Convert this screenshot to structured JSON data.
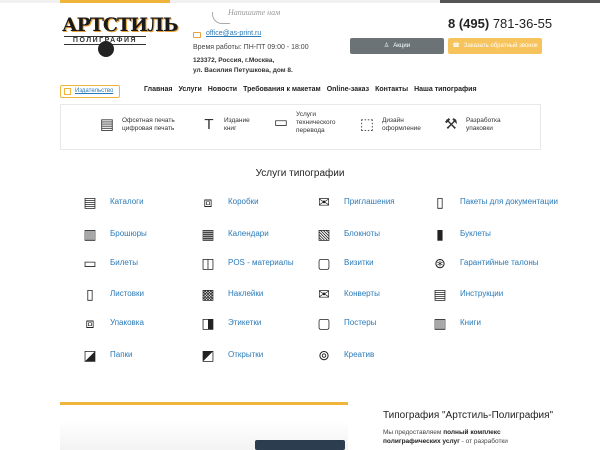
{
  "header": {
    "logo_title": "АРТСТИЛЬ",
    "logo_subtitle": "ПОЛИГРАФИЯ",
    "write_us": "Напишите нам",
    "email": "office@as-print.ru",
    "hours": "Время работы: ПН-ПТ 09:00 - 18:00",
    "address_line1": "123372, Россия, г.Москва,",
    "address_line2": "ул. Василия Петушкова, дом 8.",
    "phone_code": "8 (495)",
    "phone_number": "781-36-55",
    "promo_button": "Акции",
    "callback_button": "Заказать обратный звонок"
  },
  "nav": {
    "publisher": "Издательство",
    "items": [
      "Главная",
      "Услуги",
      "Новости",
      "Требования к макетам",
      "Online-заказ",
      "Контакты",
      "Наша типография"
    ]
  },
  "features": [
    {
      "icon": "printer-icon",
      "line1": "Офсетная печать",
      "line2": "цифровая печать",
      "line3": ""
    },
    {
      "icon": "text-icon",
      "line1": "Издание",
      "line2": "книг",
      "line3": ""
    },
    {
      "icon": "translation-icon",
      "line1": "Услуги",
      "line2": "технического",
      "line3": "перевода"
    },
    {
      "icon": "design-icon",
      "line1": "Дизайн",
      "line2": "оформление",
      "line3": ""
    },
    {
      "icon": "package-icon",
      "line1": "Разработка",
      "line2": "упаковки",
      "line3": ""
    }
  ],
  "services": {
    "title": "Услуги типографии",
    "items": [
      "Каталоги",
      "Коробки",
      "Приглашения",
      "Пакеты для документации",
      "Брошюры",
      "Календари",
      "Блокноты",
      "Буклеты",
      "Билеты",
      "POS - материалы",
      "Визитки",
      "Гарантийные талоны",
      "Листовки",
      "Наклейки",
      "Конверты",
      "Инструкции",
      "Упаковка",
      "Этикетки",
      "Постеры",
      "Книги",
      "Папки",
      "Открытки",
      "Креатив"
    ]
  },
  "about": {
    "heading": "Типография \"Артстиль-Полиграфия\"",
    "text_intro": "Мы предоставляем ",
    "text_bold": "полный комплекс полиграфических услуг",
    "text_rest": " - от разработки"
  }
}
